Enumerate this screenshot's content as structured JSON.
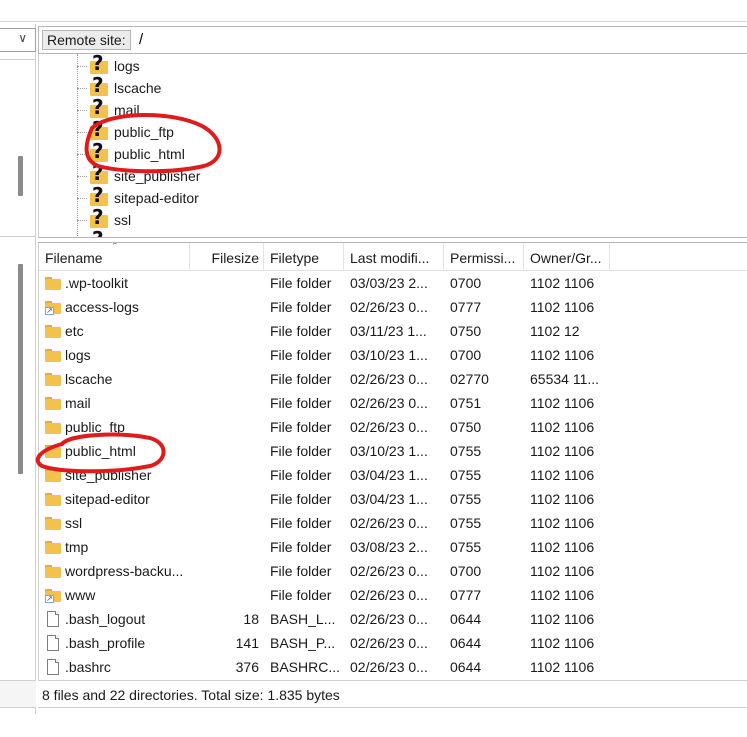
{
  "local": {
    "dropdown_chevron_icon": "chevron-down-icon"
  },
  "remote": {
    "label": "Remote site:",
    "path": "/"
  },
  "tree": {
    "items": [
      {
        "label": "logs"
      },
      {
        "label": "lscache"
      },
      {
        "label": "mail"
      },
      {
        "label": "public_ftp"
      },
      {
        "label": "public_html"
      },
      {
        "label": "site_publisher"
      },
      {
        "label": "sitepad-editor"
      },
      {
        "label": "ssl"
      }
    ]
  },
  "list": {
    "columns": [
      "Filename",
      "Filesize",
      "Filetype",
      "Last modifi...",
      "Permissi...",
      "Owner/Gr..."
    ],
    "rows": [
      {
        "icon": "folder",
        "name": ".wp-toolkit",
        "size": "",
        "type": "File folder",
        "modified": "03/03/23 2...",
        "perms": "0700",
        "owner": "1102 1106"
      },
      {
        "icon": "folder-link",
        "name": "access-logs",
        "size": "",
        "type": "File folder",
        "modified": "02/26/23 0...",
        "perms": "0777",
        "owner": "1102 1106"
      },
      {
        "icon": "folder",
        "name": "etc",
        "size": "",
        "type": "File folder",
        "modified": "03/11/23 1...",
        "perms": "0750",
        "owner": "1102 12"
      },
      {
        "icon": "folder",
        "name": "logs",
        "size": "",
        "type": "File folder",
        "modified": "03/10/23 1...",
        "perms": "0700",
        "owner": "1102 1106"
      },
      {
        "icon": "folder",
        "name": "lscache",
        "size": "",
        "type": "File folder",
        "modified": "02/26/23 0...",
        "perms": "02770",
        "owner": "65534 11..."
      },
      {
        "icon": "folder",
        "name": "mail",
        "size": "",
        "type": "File folder",
        "modified": "02/26/23 0...",
        "perms": "0751",
        "owner": "1102 1106"
      },
      {
        "icon": "folder",
        "name": "public_ftp",
        "size": "",
        "type": "File folder",
        "modified": "02/26/23 0...",
        "perms": "0750",
        "owner": "1102 1106"
      },
      {
        "icon": "folder",
        "name": "public_html",
        "size": "",
        "type": "File folder",
        "modified": "03/10/23 1...",
        "perms": "0755",
        "owner": "1102 1106"
      },
      {
        "icon": "folder",
        "name": "site_publisher",
        "size": "",
        "type": "File folder",
        "modified": "03/04/23 1...",
        "perms": "0755",
        "owner": "1102 1106"
      },
      {
        "icon": "folder",
        "name": "sitepad-editor",
        "size": "",
        "type": "File folder",
        "modified": "03/04/23 1...",
        "perms": "0755",
        "owner": "1102 1106"
      },
      {
        "icon": "folder",
        "name": "ssl",
        "size": "",
        "type": "File folder",
        "modified": "02/26/23 0...",
        "perms": "0755",
        "owner": "1102 1106"
      },
      {
        "icon": "folder",
        "name": "tmp",
        "size": "",
        "type": "File folder",
        "modified": "03/08/23 2...",
        "perms": "0755",
        "owner": "1102 1106"
      },
      {
        "icon": "folder",
        "name": "wordpress-backu...",
        "size": "",
        "type": "File folder",
        "modified": "02/26/23 0...",
        "perms": "0700",
        "owner": "1102 1106"
      },
      {
        "icon": "folder-link",
        "name": "www",
        "size": "",
        "type": "File folder",
        "modified": "02/26/23 0...",
        "perms": "0777",
        "owner": "1102 1106"
      },
      {
        "icon": "file",
        "name": ".bash_logout",
        "size": "18",
        "type": "BASH_L...",
        "modified": "02/26/23 0...",
        "perms": "0644",
        "owner": "1102 1106"
      },
      {
        "icon": "file",
        "name": ".bash_profile",
        "size": "141",
        "type": "BASH_P...",
        "modified": "02/26/23 0...",
        "perms": "0644",
        "owner": "1102 1106"
      },
      {
        "icon": "file",
        "name": ".bashrc",
        "size": "376",
        "type": "BASHRC...",
        "modified": "02/26/23 0...",
        "perms": "0644",
        "owner": "1102 1106"
      }
    ]
  },
  "status": {
    "text": "8 files and 22 directories. Total size: 1.835 bytes"
  },
  "colors": {
    "folder": "#f2c14e",
    "annotation": "#e01b1b"
  }
}
